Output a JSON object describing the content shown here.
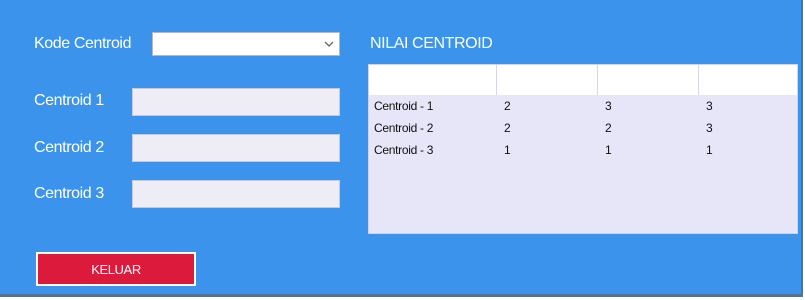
{
  "form": {
    "kode_label": "Kode Centroid",
    "kode_value": "",
    "centroid1_label": "Centroid 1",
    "centroid1_value": "",
    "centroid2_label": "Centroid 2",
    "centroid2_value": "",
    "centroid3_label": "Centroid 3",
    "centroid3_value": ""
  },
  "table": {
    "title": "NILAI CENTROID",
    "headers": [
      "",
      "",
      "",
      ""
    ],
    "rows": [
      [
        "Centroid - 1",
        "2",
        "3",
        "3"
      ],
      [
        "Centroid - 2",
        "2",
        "2",
        "3"
      ],
      [
        "Centroid - 3",
        "1",
        "1",
        "1"
      ]
    ]
  },
  "buttons": {
    "exit_label": "KELUAR"
  },
  "colors": {
    "background": "#3b93ec",
    "exit_button": "#dc1a3c",
    "grid_body": "#e6e6f8"
  },
  "icons": {
    "combo_arrow": "chevron-down-icon"
  }
}
